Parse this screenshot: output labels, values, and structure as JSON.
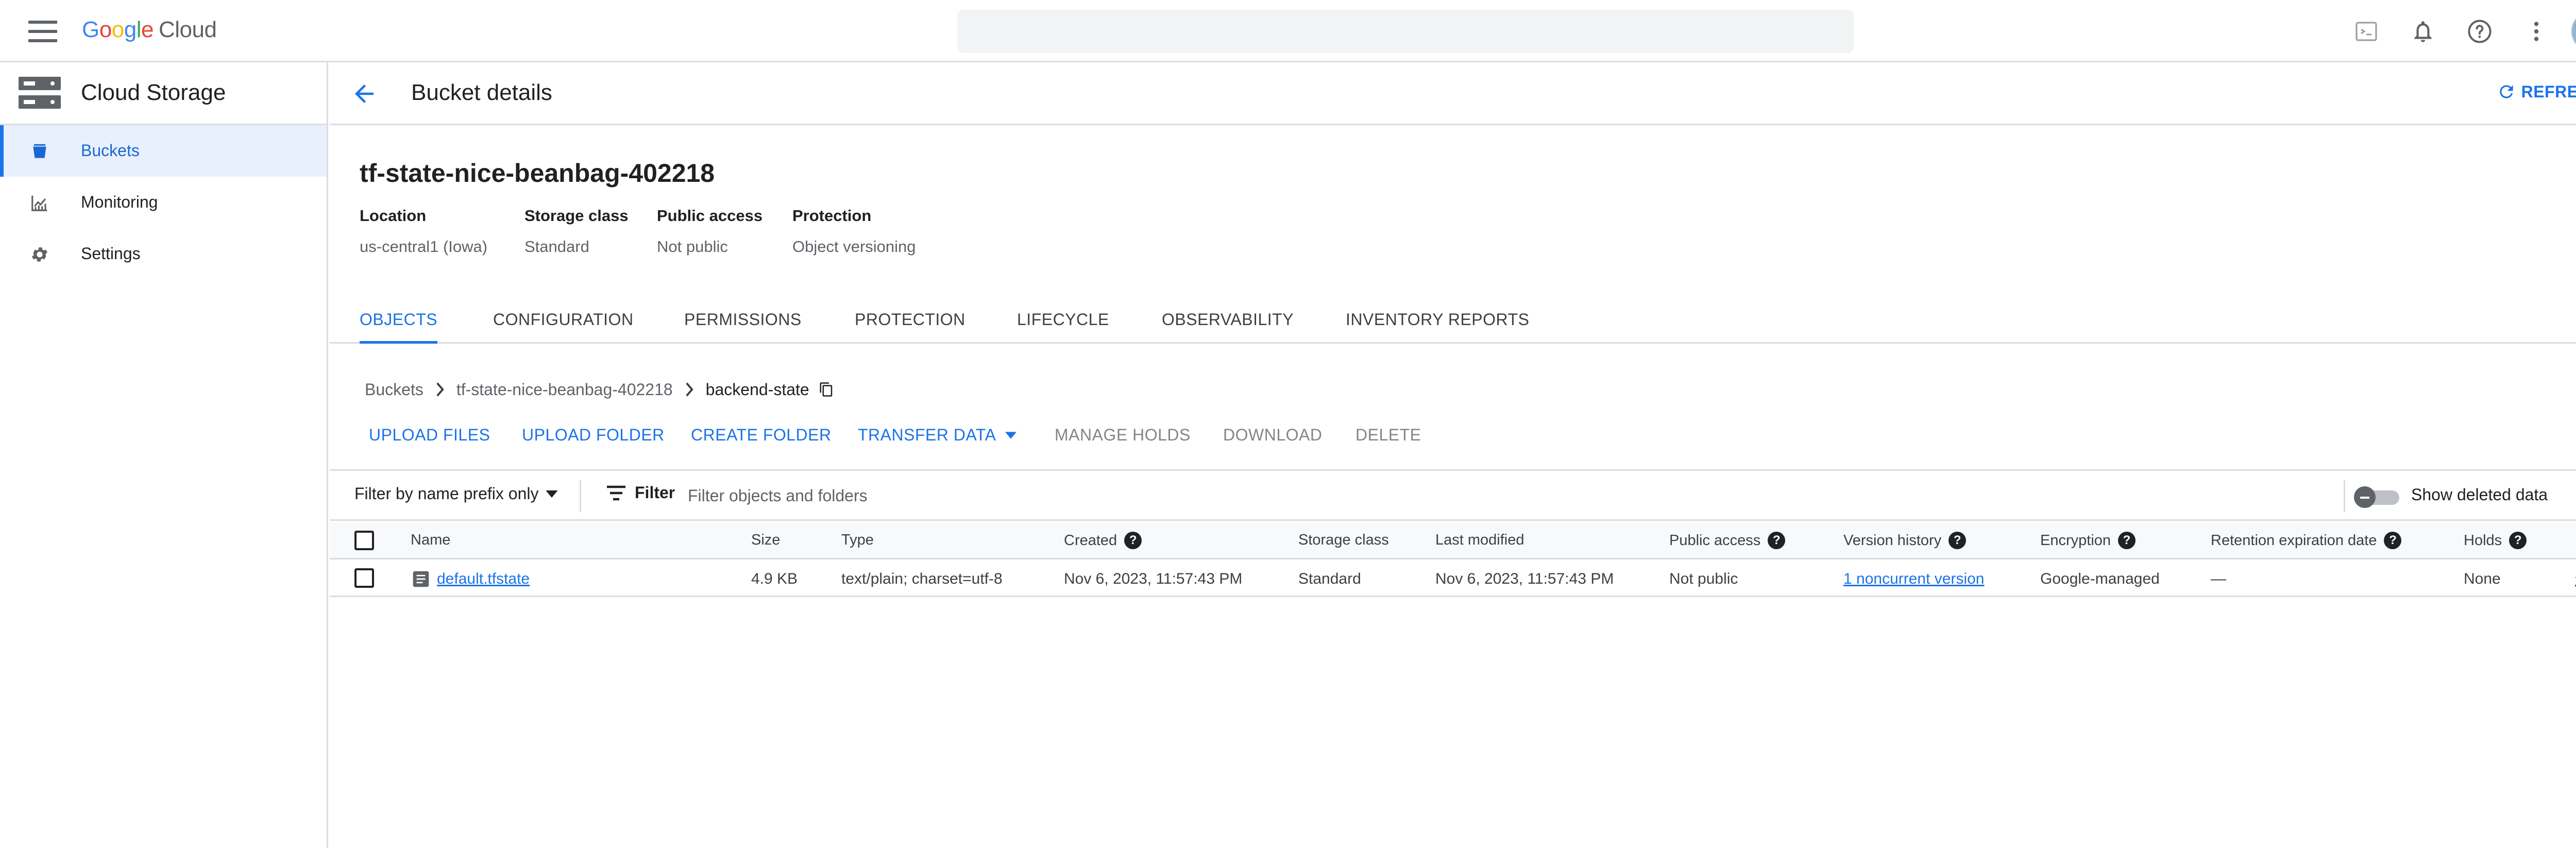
{
  "topbar": {
    "logo_google": [
      "G",
      "o",
      "o",
      "g",
      "l",
      "e"
    ],
    "logo_cloud": "Cloud",
    "search_placeholder": "",
    "icons": [
      "menu-icon",
      "terminal-icon",
      "bell-icon",
      "help-icon",
      "more-vert-icon",
      "avatar"
    ]
  },
  "sidebar": {
    "product_title": "Cloud Storage",
    "items": [
      {
        "label": "Buckets",
        "icon": "bucket-icon",
        "active": true
      },
      {
        "label": "Monitoring",
        "icon": "chart-icon",
        "active": false
      },
      {
        "label": "Settings",
        "icon": "gear-icon",
        "active": false
      }
    ]
  },
  "header": {
    "title": "Bucket details",
    "refresh_label": "REFRESH"
  },
  "bucket": {
    "name": "tf-state-nice-beanbag-402218",
    "summary": [
      {
        "label": "Location",
        "value": "us-central1 (Iowa)"
      },
      {
        "label": "Storage class",
        "value": "Standard"
      },
      {
        "label": "Public access",
        "value": "Not public"
      },
      {
        "label": "Protection",
        "value": "Object versioning"
      }
    ]
  },
  "tabs": [
    {
      "label": "OBJECTS",
      "active": true
    },
    {
      "label": "CONFIGURATION",
      "active": false
    },
    {
      "label": "PERMISSIONS",
      "active": false
    },
    {
      "label": "PROTECTION",
      "active": false
    },
    {
      "label": "LIFECYCLE",
      "active": false
    },
    {
      "label": "OBSERVABILITY",
      "active": false
    },
    {
      "label": "INVENTORY REPORTS",
      "active": false
    }
  ],
  "breadcrumb": [
    "Buckets",
    "tf-state-nice-beanbag-402218",
    "backend-state"
  ],
  "actions": [
    {
      "label": "UPLOAD FILES",
      "enabled": true
    },
    {
      "label": "UPLOAD FOLDER",
      "enabled": true
    },
    {
      "label": "CREATE FOLDER",
      "enabled": true
    },
    {
      "label": "TRANSFER DATA",
      "enabled": true
    },
    {
      "label": "MANAGE HOLDS",
      "enabled": false
    },
    {
      "label": "DOWNLOAD",
      "enabled": false
    },
    {
      "label": "DELETE",
      "enabled": false
    }
  ],
  "filter": {
    "prefix_select": "Filter by name prefix only",
    "filter_label": "Filter",
    "placeholder": "Filter objects and folders",
    "show_deleted_label": "Show deleted data",
    "show_deleted_on": false
  },
  "table": {
    "columns": [
      "Name",
      "Size",
      "Type",
      "Created",
      "Storage class",
      "Last modified",
      "Public access",
      "Version history",
      "Encryption",
      "Retention expiration date",
      "Holds"
    ],
    "rows": [
      {
        "name": "default.tfstate",
        "size": "4.9 KB",
        "type": "text/plain; charset=utf-8",
        "created": "Nov 6, 2023, 11:57:43 PM",
        "storage_class": "Standard",
        "last_modified": "Nov 6, 2023, 11:57:43 PM",
        "public_access": "Not public",
        "version_history": "1 noncurrent version",
        "encryption": "Google-managed",
        "retention": "—",
        "holds": "None"
      }
    ]
  },
  "colors": {
    "accent": "#1a73e8",
    "active_nav_bg": "#e8f0fe",
    "border": "#dadce0",
    "text_secondary": "#5f6368"
  }
}
